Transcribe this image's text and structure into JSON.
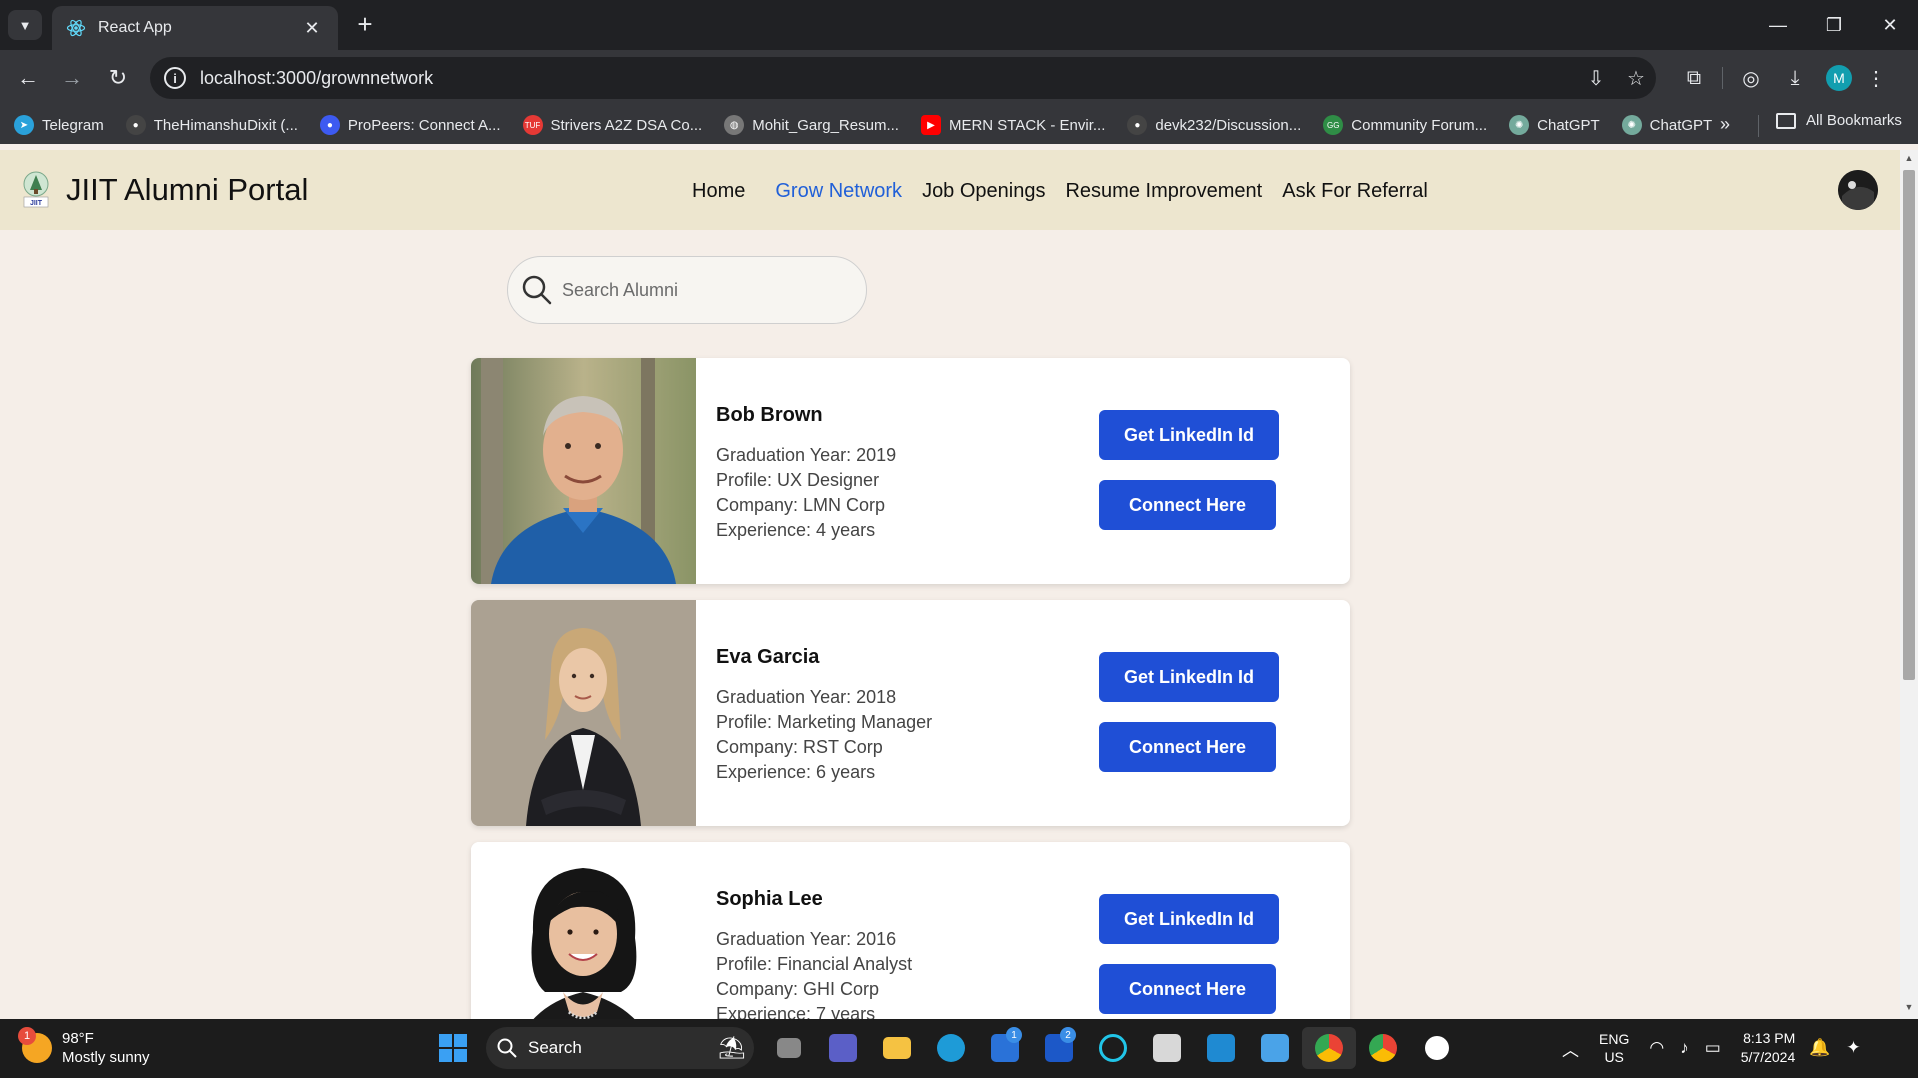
{
  "browser": {
    "tab_title": "React App",
    "url": "localhost:3000/grownnetwork",
    "bookmarks": [
      {
        "label": "Telegram",
        "icon": "telegram-icon",
        "color": "#2aa1da"
      },
      {
        "label": "TheHimanshuDixit (...",
        "icon": "github-icon",
        "color": "#444444"
      },
      {
        "label": "ProPeers: Connect A...",
        "icon": "propeers-icon",
        "color": "#3d5af1"
      },
      {
        "label": "Strivers A2Z DSA Co...",
        "icon": "tuf-icon",
        "color": "#e53935"
      },
      {
        "label": "Mohit_Garg_Resum...",
        "icon": "globe-icon",
        "color": "#777777"
      },
      {
        "label": "MERN STACK - Envir...",
        "icon": "youtube-icon",
        "color": "#ff0000"
      },
      {
        "label": "devk232/Discussion...",
        "icon": "github-icon",
        "color": "#444444"
      },
      {
        "label": "Community Forum...",
        "icon": "gfg-icon",
        "color": "#2f8d46"
      },
      {
        "label": "ChatGPT",
        "icon": "chatgpt-icon",
        "color": "#74aa9c"
      },
      {
        "label": "ChatGPT",
        "icon": "chatgpt-icon",
        "color": "#74aa9c"
      }
    ],
    "all_bookmarks_label": "All Bookmarks",
    "profile_initial": "M"
  },
  "app": {
    "brand_title": "JIIT Alumni Portal",
    "logo_text": "JIIT",
    "nav": [
      {
        "label": "Home",
        "active": false
      },
      {
        "label": "Grow Network",
        "active": true
      },
      {
        "label": "Job Openings",
        "active": false
      },
      {
        "label": "Resume Improvement",
        "active": false
      },
      {
        "label": "Ask For Referral",
        "active": false
      }
    ],
    "search_placeholder": "Search Alumni",
    "alumni": [
      {
        "name": "Bob Brown",
        "graduation": "Graduation Year: 2019",
        "profile": "Profile: UX Designer",
        "company": "Company: LMN Corp",
        "experience": "Experience: 4 years",
        "linkedin_label": "Get LinkedIn Id",
        "connect_label": "Connect Here"
      },
      {
        "name": "Eva Garcia",
        "graduation": "Graduation Year: 2018",
        "profile": "Profile: Marketing Manager",
        "company": "Company: RST Corp",
        "experience": "Experience: 6 years",
        "linkedin_label": "Get LinkedIn Id",
        "connect_label": "Connect Here"
      },
      {
        "name": "Sophia Lee",
        "graduation": "Graduation Year: 2016",
        "profile": "Profile: Financial Analyst",
        "company": "Company: GHI Corp",
        "experience": "Experience: 7 years",
        "linkedin_label": "Get LinkedIn Id",
        "connect_label": "Connect Here"
      }
    ],
    "colors": {
      "accent": "#1f4fd6",
      "active_nav": "#2160d8",
      "navbar_bg": "#ede6cf",
      "page_bg": "#f5eee8"
    }
  },
  "taskbar": {
    "weather_temp": "98°F",
    "weather_desc": "Mostly sunny",
    "weather_badge": "1",
    "search_label": "Search",
    "lang_top": "ENG",
    "lang_bottom": "US",
    "time": "8:13 PM",
    "date": "5/7/2024",
    "badges": {
      "store": "1",
      "lens": "2"
    }
  }
}
